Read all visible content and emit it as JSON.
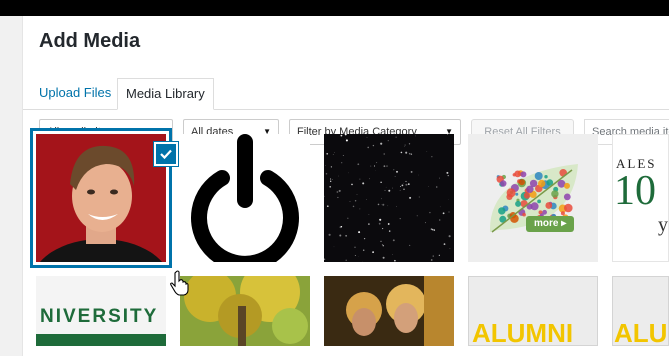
{
  "modal": {
    "title": "Add Media"
  },
  "tabs": [
    {
      "label": "Upload Files",
      "active": false
    },
    {
      "label": "Media Library",
      "active": true
    }
  ],
  "filters": {
    "media_type": "All media items",
    "dates": "All dates",
    "category": "Filter by Media Category",
    "reset_label": "Reset All Filters",
    "search_placeholder": "Search media items..."
  },
  "thumbnails": {
    "leaf_more": "more ▸",
    "ales_text": "ALES",
    "ales_number": "10",
    "ales_sub": "y",
    "university_text": "NIVERSITY",
    "alumni_text": "ALUMNI",
    "alumni_text2": "ALUM"
  },
  "colors": {
    "accent": "#0073aa",
    "ales_green": "#1e6b3a",
    "alumni_yellow": "#f2c500"
  }
}
